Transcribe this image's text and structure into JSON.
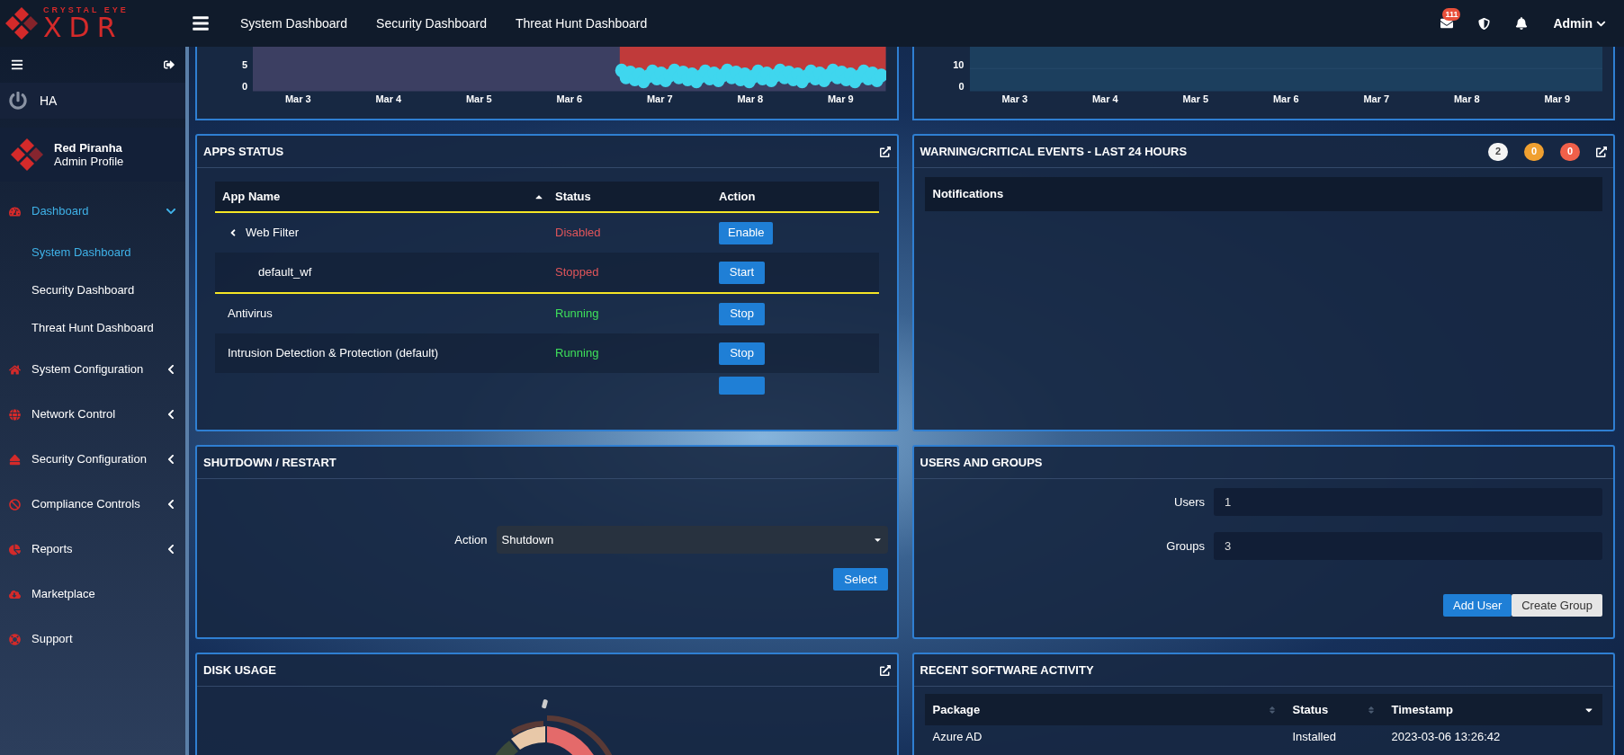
{
  "header": {
    "logo_top": "CRYSTAL EYE",
    "logo_main": "XDR",
    "nav": [
      "System Dashboard",
      "Security Dashboard",
      "Threat Hunt Dashboard"
    ],
    "mail_badge": "111",
    "user": "Admin"
  },
  "sidebar": {
    "quick_item": "HA",
    "profile": {
      "name": "Red Piranha",
      "role": "Admin Profile"
    },
    "menu": [
      {
        "label": "Dashboard",
        "kind": "group",
        "expanded": true,
        "selected": true,
        "children": [
          {
            "label": "System Dashboard",
            "selected": true
          },
          {
            "label": "Security Dashboard",
            "selected": false
          },
          {
            "label": "Threat Hunt Dashboard",
            "selected": false
          }
        ]
      },
      {
        "label": "System Configuration",
        "kind": "group",
        "expanded": false,
        "selected": false
      },
      {
        "label": "Network Control",
        "kind": "group",
        "expanded": false,
        "selected": false
      },
      {
        "label": "Security Configuration",
        "kind": "group",
        "expanded": false,
        "selected": false
      },
      {
        "label": "Compliance Controls",
        "kind": "group",
        "expanded": false,
        "selected": false
      },
      {
        "label": "Reports",
        "kind": "group",
        "expanded": false,
        "selected": false
      },
      {
        "label": "Marketplace",
        "kind": "link",
        "selected": false
      },
      {
        "label": "Support",
        "kind": "link",
        "selected": false
      }
    ]
  },
  "charts": [
    {
      "y_labels": [
        "5",
        "0"
      ],
      "x_labels": [
        "Mar 3",
        "Mar 4",
        "Mar 5",
        "Mar 6",
        "Mar 7",
        "Mar 8",
        "Mar 9"
      ],
      "kind": "scatter"
    },
    {
      "y_labels": [
        "10",
        "0"
      ],
      "x_labels": [
        "Mar 3",
        "Mar 4",
        "Mar 5",
        "Mar 6",
        "Mar 7",
        "Mar 8",
        "Mar 9"
      ],
      "kind": "area"
    }
  ],
  "apps_status": {
    "title": "APPS STATUS",
    "columns": [
      "App Name",
      "Status",
      "Action"
    ],
    "rows": [
      {
        "name": "Web Filter",
        "status": "Disabled",
        "running": false,
        "action": "Enable",
        "expanded": true,
        "highlighted": true,
        "children": [
          {
            "name": "default_wf",
            "status": "Stopped",
            "running": false,
            "action": "Start"
          }
        ]
      },
      {
        "name": "Antivirus",
        "status": "Running",
        "running": true,
        "action": "Stop",
        "highlighted": false
      },
      {
        "name": "Intrusion Detection & Protection (default)",
        "status": "Running",
        "running": true,
        "action": "Stop",
        "highlighted": false
      }
    ]
  },
  "events": {
    "title": "WARNING/CRITICAL EVENTS - LAST 24 HOURS",
    "counts": [
      {
        "value": "2",
        "color": "#f4f4f4"
      },
      {
        "value": "0",
        "color": "#f0a030"
      },
      {
        "value": "0",
        "color": "#f0604a"
      }
    ],
    "notifications_heading": "Notifications"
  },
  "shutdown": {
    "title": "SHUTDOWN / RESTART",
    "label": "Action",
    "value": "Shutdown",
    "button": "Select"
  },
  "users_groups": {
    "title": "USERS AND GROUPS",
    "fields": [
      {
        "label": "Users",
        "value": "1"
      },
      {
        "label": "Groups",
        "value": "3"
      }
    ],
    "buttons": [
      {
        "label": "Add User",
        "kind": "primary"
      },
      {
        "label": "Create Group",
        "kind": "secondary"
      }
    ]
  },
  "disk_usage": {
    "title": "DISK USAGE"
  },
  "software": {
    "title": "RECENT SOFTWARE ACTIVITY",
    "columns": [
      {
        "label": "Package",
        "kind": "sortable"
      },
      {
        "label": "Status",
        "kind": "sortable"
      },
      {
        "label": "Timestamp",
        "kind": "sorted"
      }
    ],
    "rows": [
      [
        "Azure AD",
        "Installed",
        "2023-03-06 13:26:42"
      ]
    ]
  }
}
